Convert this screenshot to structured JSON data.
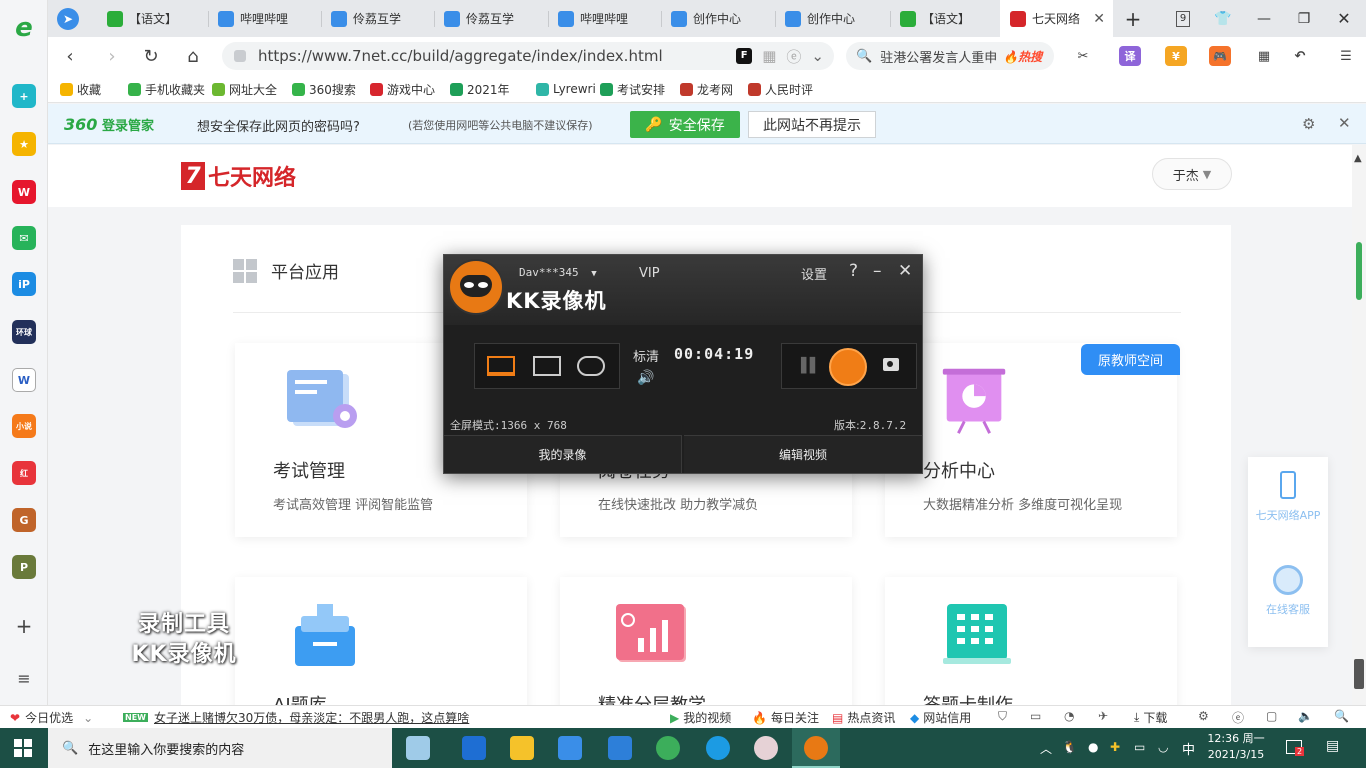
{
  "browser": {
    "tabs": [
      {
        "label": "【语文】",
        "icon": "wechat-icon",
        "color": "#2bad3a"
      },
      {
        "label": "哔哩哔哩",
        "icon": "bilibili-icon",
        "color": "#3a8ee8"
      },
      {
        "label": "伶荔互学",
        "icon": "bilibili-icon",
        "color": "#3a8ee8"
      },
      {
        "label": "伶荔互学",
        "icon": "bilibili-icon",
        "color": "#3a8ee8"
      },
      {
        "label": "哔哩哔哩",
        "icon": "bilibili-icon",
        "color": "#3a8ee8"
      },
      {
        "label": "创作中心",
        "icon": "bilibili-icon",
        "color": "#3a8ee8"
      },
      {
        "label": "创作中心",
        "icon": "bilibili-icon",
        "color": "#3a8ee8"
      },
      {
        "label": "【语文】",
        "icon": "wechat-icon",
        "color": "#2bad3a"
      },
      {
        "label": "七天网络",
        "icon": "seven-logo-icon",
        "color": "#d5262a",
        "active": true
      }
    ],
    "tab_count": "9",
    "url": "https://www.7net.cc/build/aggregate/index/index.html",
    "search_text": "驻港公署发言人重申",
    "search_hot": "热搜",
    "translate_label": "译"
  },
  "bookmarks": [
    {
      "label": "收藏",
      "color": "#f5b400"
    },
    {
      "label": "手机收藏夹",
      "color": "#36b24a"
    },
    {
      "label": "网址大全",
      "color": "#6cb831"
    },
    {
      "label": "360搜索",
      "color": "#35b44a"
    },
    {
      "label": "游戏中心",
      "color": "#d7262e"
    },
    {
      "label": "2021年",
      "color": "#1e9f58"
    },
    {
      "label": "Lyrewri",
      "color": "#2fb6a7"
    },
    {
      "label": "考试安排",
      "color": "#1e9f58"
    },
    {
      "label": "龙考网",
      "color": "#c0392b"
    },
    {
      "label": "人民时评",
      "color": "#c0392b"
    }
  ],
  "password_bar": {
    "brand": "360",
    "brand_suffix": "登录管家",
    "question": "想安全保存此网页的密码吗?",
    "note": "(若您使用网吧等公共电脑不建议保存)",
    "save_label": "安全保存",
    "never_label": "此网站不再提示"
  },
  "site": {
    "logo_mark": "7",
    "logo_text": "七天网络",
    "user_name": "于杰",
    "section_title": "平台应用",
    "teacher_badge": "原教师空间",
    "cards": [
      {
        "title": "考试管理",
        "desc": "考试高效管理 评阅智能监管"
      },
      {
        "title": "阅卷任务",
        "desc": "在线快速批改 助力教学减负"
      },
      {
        "title": "分析中心",
        "desc": "大数据精准分析 多维度可视化呈现"
      },
      {
        "title": "AI题库",
        "desc": ""
      },
      {
        "title": "精准分层教学",
        "desc": ""
      },
      {
        "title": "答题卡制作",
        "desc": ""
      }
    ],
    "side_app": "七天网络APP",
    "side_service": "在线客服"
  },
  "recorder": {
    "title": "KK录像机",
    "user": "Dav***345",
    "vip": "VIP",
    "settings": "设置",
    "help": "?",
    "quality": "标清",
    "elapsed": "00:04:19",
    "fullscreen_label": "全屏模式:",
    "fullscreen_res": "1366 x 768",
    "version_label": "版本:",
    "version": "2.8.7.2",
    "my_videos": "我的录像",
    "edit_video": "编辑视频",
    "accent": "#f07d16"
  },
  "watermark": {
    "line1": "录制工具",
    "line2": "KK录像机"
  },
  "statusbar": {
    "daily": "今日优选",
    "news_badge": "NEW",
    "headline": "女子迷上赌博欠30万债，母亲淡定：不跟男人跑，这点算啥",
    "my_video": "我的视频",
    "daily_focus": "每日关注",
    "hot_news": "热点资讯",
    "site_trust": "网站信用",
    "download": "下载"
  },
  "taskbar": {
    "search_placeholder": "在这里输入你要搜索的内容",
    "ime": "中",
    "time": "12:36 周一",
    "date": "2021/3/15",
    "notif_count": "2"
  }
}
